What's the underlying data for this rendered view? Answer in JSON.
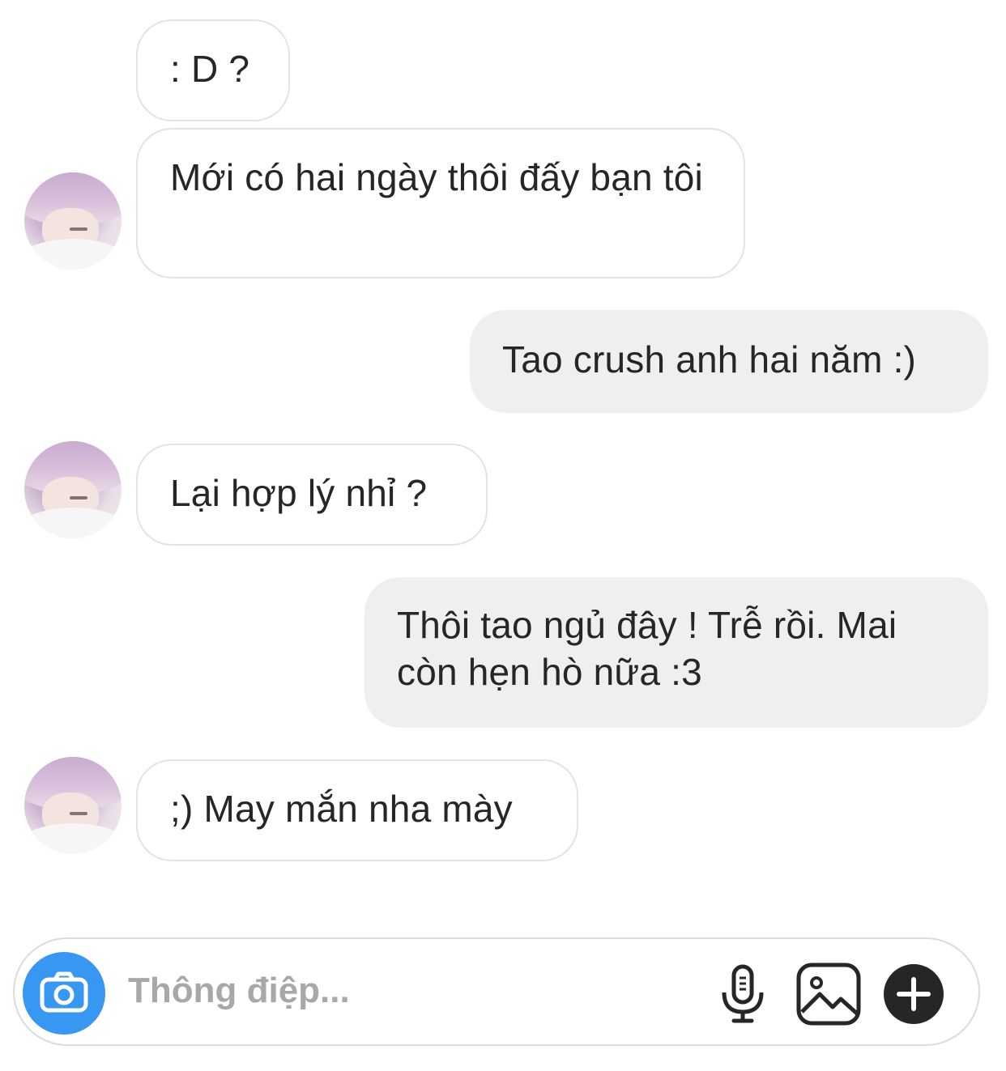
{
  "messages": [
    {
      "side": "in",
      "text": ": D ?",
      "avatar": false
    },
    {
      "side": "in",
      "text": "Mới có hai ngày thôi đấy bạn tôi",
      "avatar": true
    },
    {
      "side": "out",
      "text": "Tao crush anh hai năm :)"
    },
    {
      "side": "in",
      "text": "Lại hợp lý nhỉ ?",
      "avatar": true
    },
    {
      "side": "out",
      "text": "Thôi tao ngủ đây ! Trễ rồi. Mai còn hẹn hò nữa :3"
    },
    {
      "side": "in",
      "text": ";) May mắn nha mày",
      "avatar": true
    }
  ],
  "composer": {
    "placeholder": "Thông điệp...",
    "icons": [
      "camera-icon",
      "microphone-icon",
      "gallery-icon",
      "plus-icon"
    ],
    "camera_color": "#3897f0"
  },
  "colors": {
    "incoming_bubble": "#ffffff",
    "outgoing_bubble": "#efefef",
    "text": "#262626"
  }
}
